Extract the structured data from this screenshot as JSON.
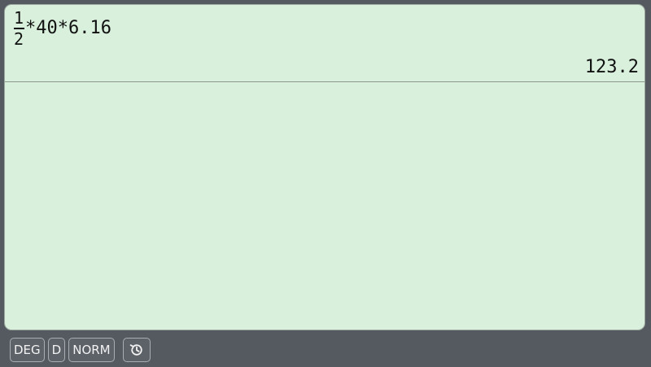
{
  "expression": {
    "fraction_numerator": "1",
    "fraction_denominator": "2",
    "rest": "*40*6.16"
  },
  "result": "123.2",
  "status_bar": {
    "angle_mode": "DEG",
    "display_mode": "D",
    "notation_mode": "NORM",
    "history_icon": "history-icon"
  },
  "colors": {
    "screen_background": "#d9f1dc",
    "frame_background": "#555960",
    "text": "#111111",
    "pill_text": "#f2f2f2"
  }
}
